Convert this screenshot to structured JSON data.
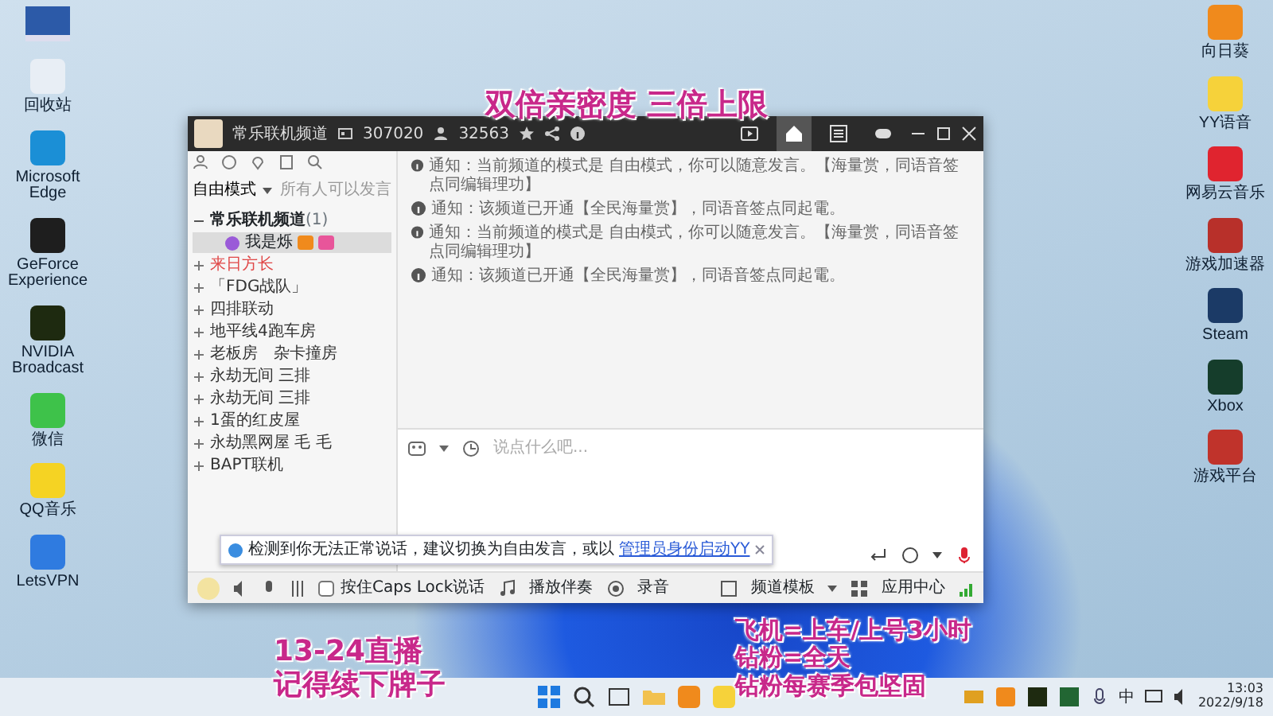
{
  "overlay_captions": {
    "top": "双倍亲密度 三倍上限",
    "bottom_left": [
      "13-24直播",
      "记得续下牌子"
    ],
    "bottom_right": [
      "飞机=上车/上号3小时",
      "钻粉=全天",
      "钻粉每赛季包坚固"
    ]
  },
  "desktop_icons_left": [
    {
      "label": "回收站",
      "color": "#e8eef5"
    },
    {
      "label": "Microsoft Edge",
      "color": "#1b8fd6"
    },
    {
      "label": "GeForce Experience",
      "color": "#1e1e1e"
    },
    {
      "label": "NVIDIA Broadcast",
      "color": "#1e2a10"
    },
    {
      "label": "微信",
      "color": "#3ec24a"
    },
    {
      "label": "QQ音乐",
      "color": "#f5d323"
    },
    {
      "label": "LetsVPN",
      "color": "#2f7be0"
    }
  ],
  "desktop_icons_right": [
    {
      "label": "向日葵",
      "color": "#f08a1c"
    },
    {
      "label": "YY语音",
      "color": "#f6d23a"
    },
    {
      "label": "网易云音乐",
      "color": "#e0242f"
    },
    {
      "label": "游戏加速器",
      "color": "#b8302a"
    },
    {
      "label": "Steam",
      "color": "#1b3a66"
    },
    {
      "label": "Xbox",
      "color": "#153d2b"
    },
    {
      "label": "游戏平台",
      "color": "#c0332b"
    }
  ],
  "window": {
    "channel_name": "常乐联机频道",
    "channel_id": "307020",
    "online_count": "32563",
    "toolbar_tabs": [
      {
        "kind": "video",
        "selected": false
      },
      {
        "kind": "home",
        "selected": true
      },
      {
        "kind": "list",
        "selected": false
      },
      {
        "kind": "game",
        "selected": false
      }
    ],
    "mode": "自由模式",
    "speak_rule": "所有人可以发言",
    "channel_tree": {
      "name": "常乐联机频道",
      "count": "(1)",
      "expanded": true,
      "children": [
        {
          "kind": "user",
          "name": "我是烁",
          "selected": true
        },
        {
          "kind": "channel",
          "name": "来日方长",
          "color": "#e04848"
        },
        {
          "kind": "channel",
          "name": "「FDG战队」",
          "color": "#333333"
        },
        {
          "kind": "channel",
          "name": "四排联动",
          "color": "#333333"
        },
        {
          "kind": "channel",
          "name": "地平线4跑车房",
          "color": "#333333"
        },
        {
          "kind": "channel",
          "name": "老板房　杂卡撞房",
          "color": "#333333"
        },
        {
          "kind": "channel",
          "name": "永劫无间 三排",
          "color": "#333333"
        },
        {
          "kind": "channel",
          "name": "永劫无间 三排",
          "color": "#333333"
        },
        {
          "kind": "channel",
          "name": "1蛋的红皮屋",
          "color": "#333333"
        },
        {
          "kind": "channel",
          "name": "永劫黑网屋 毛 毛",
          "color": "#333333"
        },
        {
          "kind": "channel",
          "name": "BAPT联机",
          "color": "#333333"
        }
      ]
    },
    "messages": [
      {
        "label": "通知：",
        "text": "当前频道的模式是 自由模式，你可以随意发言。【海量赏，同语音签点同编辑理功】"
      },
      {
        "label": "通知：",
        "text": "该频道已开通【全民海量赏】，同语音签点同起電。"
      },
      {
        "label": "通知：",
        "text": "当前频道的模式是 自由模式，你可以随意发言。【海量赏，同语音签点同编辑理功】"
      },
      {
        "label": "通知：",
        "text": "该频道已开通【全民海量赏】，同语音签点同起電。"
      }
    ],
    "input": {
      "placeholder": "说点什么吧..."
    },
    "tooltip": {
      "text": "检测到你无法正常说话，建议切换为自由发言，或以",
      "link": "管理员身份启动YY"
    },
    "bottom_bar": {
      "caps_lock": {
        "label": "按住Caps Lock说话",
        "checked": false
      },
      "play": "播放伴奏",
      "record": "录音",
      "template": "频道模板",
      "app_center": "应用中心"
    }
  },
  "taskbar": {
    "ime": "中",
    "time": "13:03",
    "date": "2022/9/18"
  }
}
